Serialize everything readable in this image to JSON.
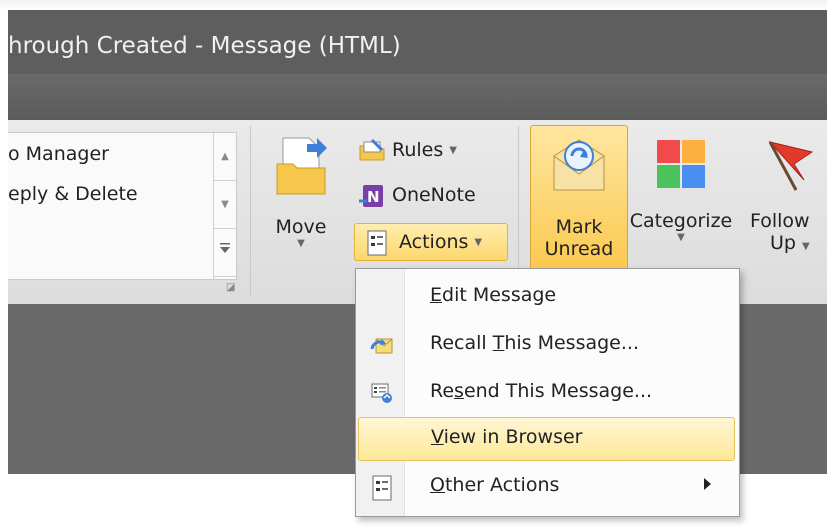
{
  "window": {
    "title": "hrough Created - Message (HTML)"
  },
  "quick_steps": {
    "items": [
      "o Manager",
      "eply & Delete"
    ]
  },
  "ribbon": {
    "move_label": "Move",
    "rules_label": "Rules",
    "onenote_label": "OneNote",
    "actions_label": "Actions",
    "mark_unread_line1": "Mark",
    "mark_unread_line2": "Unread",
    "categorize_label": "Categorize",
    "follow_up_line1": "Follow",
    "follow_up_line2": "Up"
  },
  "actions_menu": {
    "items": [
      {
        "pre": "",
        "key": "E",
        "post": "dit Message",
        "icon": ""
      },
      {
        "pre": "Recall ",
        "key": "T",
        "post": "his Message...",
        "icon": "recall-icon"
      },
      {
        "pre": "Re",
        "key": "s",
        "post": "end This Message...",
        "icon": "resend-icon"
      },
      {
        "pre": "",
        "key": "V",
        "post": "iew in Browser",
        "icon": "",
        "highlighted": true
      },
      {
        "pre": "",
        "key": "O",
        "post": "ther Actions",
        "icon": "other-actions-icon",
        "submenu": true
      }
    ]
  },
  "colors": {
    "accent": "#fbd66c",
    "titlebar": "#5e5e5e"
  }
}
